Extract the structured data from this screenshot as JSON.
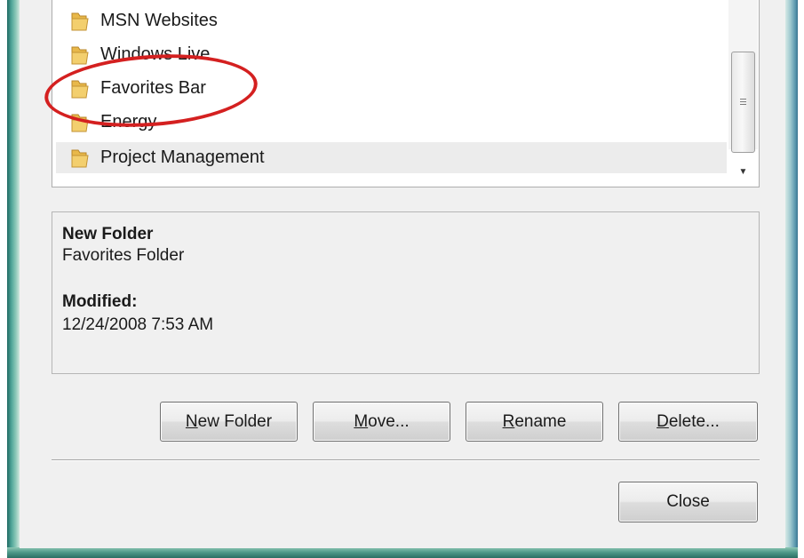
{
  "folders": [
    {
      "label": "MSN Websites",
      "selected": false
    },
    {
      "label": "Windows Live",
      "selected": false
    },
    {
      "label": "Favorites Bar",
      "selected": false
    },
    {
      "label": "Energy",
      "selected": false
    },
    {
      "label": "Project Management",
      "selected": true
    }
  ],
  "details": {
    "name": "New Folder",
    "type": "Favorites Folder",
    "modified_label": "Modified:",
    "modified_value": "12/24/2008 7:53 AM"
  },
  "buttons": {
    "new_folder": {
      "accel": "N",
      "rest": "ew Folder"
    },
    "move": {
      "accel": "M",
      "rest": "ove..."
    },
    "rename": {
      "accel": "R",
      "rest": "ename"
    },
    "delete": {
      "accel": "D",
      "rest": "elete..."
    },
    "close": "Close"
  },
  "colors": {
    "annotation": "#d42020",
    "folder_icon": "#e8b84a",
    "frame_accent": "#4fa598"
  },
  "icons": {
    "folder": "folder-icon",
    "scroll_grip": "scroll-grip-icon",
    "scroll_down": "scroll-down-arrow-icon"
  }
}
